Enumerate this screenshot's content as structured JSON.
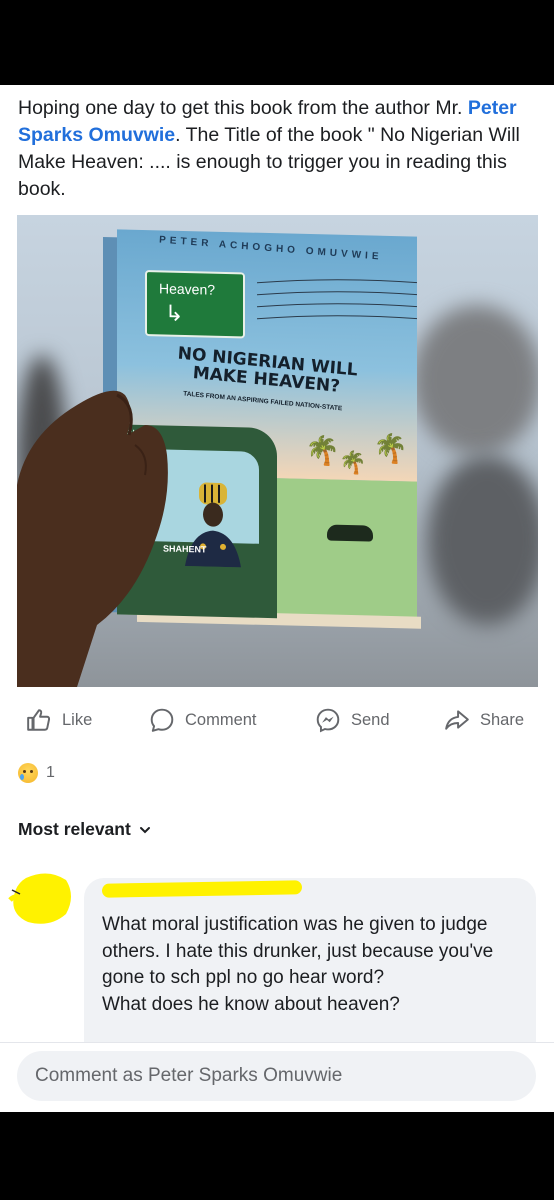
{
  "post": {
    "text_before": "Hoping one day to get this book from the author Mr. ",
    "author_link": "Peter Sparks Omuvwie",
    "text_after": ". The Title of the book \" No Nigerian Will Make Heaven: .... is enough to trigger you in reading this book."
  },
  "book": {
    "author": "PETER ACHOGHO OMUVWIE",
    "sign_text": "Heaven?",
    "title_line1": "NO NIGERIAN WILL",
    "title_line2": "MAKE HEAVEN?",
    "subtitle": "TALES FROM AN ASPIRING FAILED NATION-STATE",
    "window_text": "Shall...",
    "plate_text": "SHAHENT"
  },
  "actions": {
    "like": "Like",
    "comment": "Comment",
    "send": "Send",
    "share": "Share"
  },
  "reactions": {
    "icon": "sad-emoji",
    "count": "1"
  },
  "comments": {
    "sort_label": "Most relevant",
    "items": [
      {
        "text": "What moral justification was he given to judge others. I hate this drunker, just because you've gone to sch ppl no go hear word?\nWhat does he know about heaven?"
      }
    ]
  },
  "composer": {
    "placeholder": "Comment as Peter Sparks Omuvwie"
  },
  "colors": {
    "link": "#216fdb",
    "muted": "#65676b",
    "bubble": "#f0f2f5",
    "redaction": "#fff200"
  }
}
